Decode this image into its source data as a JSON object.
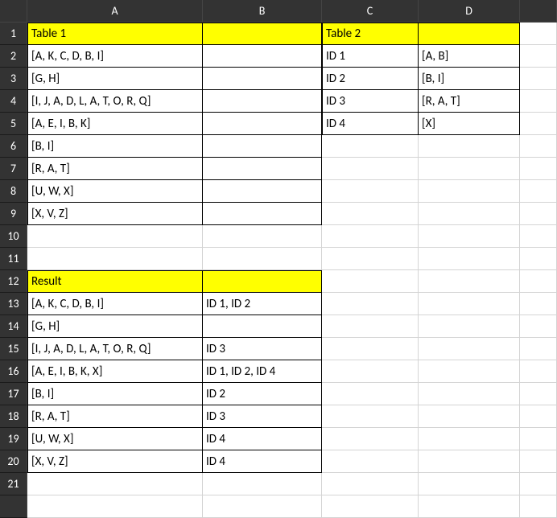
{
  "columns": [
    "A",
    "B",
    "C",
    "D",
    ""
  ],
  "rows": [
    "1",
    "2",
    "3",
    "4",
    "5",
    "6",
    "7",
    "8",
    "9",
    "10",
    "11",
    "12",
    "13",
    "14",
    "15",
    "16",
    "17",
    "18",
    "19",
    "20",
    "21"
  ],
  "table1": {
    "header": "Table 1",
    "items": [
      "[A, K, C, D, B, I]",
      "[G, H]",
      "[I, J, A, D, L, A, T, O, R, Q]",
      "[A, E, I, B, K]",
      "[B, I]",
      "[R, A, T]",
      "[U, W, X]",
      "[X, V, Z]"
    ]
  },
  "table2": {
    "header": "Table 2",
    "rows": [
      {
        "id": "ID 1",
        "val": "[A, B]"
      },
      {
        "id": "ID 2",
        "val": "[B, I]"
      },
      {
        "id": "ID 3",
        "val": "[R, A, T]"
      },
      {
        "id": "ID 4",
        "val": "[X]"
      }
    ]
  },
  "result": {
    "header": "Result",
    "rows": [
      {
        "set": "[A, K, C, D, B, I]",
        "ids": "ID 1, ID 2"
      },
      {
        "set": "[G, H]",
        "ids": ""
      },
      {
        "set": "[I, J, A, D, L, A, T, O, R, Q]",
        "ids": "ID 3"
      },
      {
        "set": "[A, E, I, B, K, X]",
        "ids": "ID 1, ID 2, ID 4"
      },
      {
        "set": "[B, I]",
        "ids": "ID 2"
      },
      {
        "set": "[R, A, T]",
        "ids": "ID 3"
      },
      {
        "set": "[U, W, X]",
        "ids": "ID 4"
      },
      {
        "set": "[X, V, Z]",
        "ids": "ID 4"
      }
    ]
  }
}
